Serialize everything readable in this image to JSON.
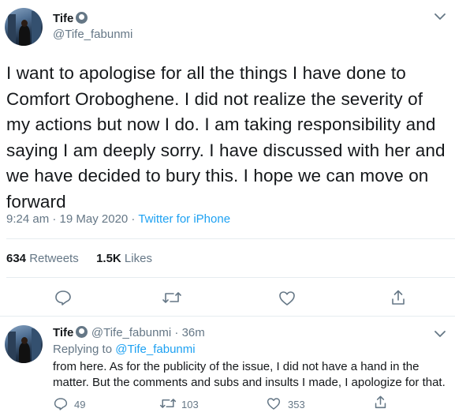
{
  "tweet": {
    "author_name": "Tife",
    "author_handle": "@Tife_fabunmi",
    "emoji_icon": "face-emoji-icon",
    "text": "I want to apologise for all the things I have done to Comfort Oroboghene. I did not realize the severity of my actions but now I do. I am taking responsibility and saying I am deeply sorry. I have discussed with her and we have decided to bury this. I hope we can move on forward",
    "time": "9:24 am · 19 May 2020 · ",
    "source": "Twitter for iPhone",
    "retweets_count": "634",
    "retweets_label": " Retweets",
    "likes_count": "1.5K",
    "likes_label": " Likes"
  },
  "reply": {
    "author_name": "Tife",
    "author_handle": "@Tife_fabunmi · 36m",
    "replying_prefix": "Replying to ",
    "replying_handle": "@Tife_fabunmi",
    "text": "from here. As for the publicity of the issue, I did not have a hand in the matter. But the comments and subs and insults I made, I apologize for that.",
    "reply_count": "49",
    "retweet_count": "103",
    "like_count": "353"
  },
  "colors": {
    "text": "#14171a",
    "secondary": "#657786",
    "link": "#1da1f2",
    "divider": "#e6ecf0"
  }
}
